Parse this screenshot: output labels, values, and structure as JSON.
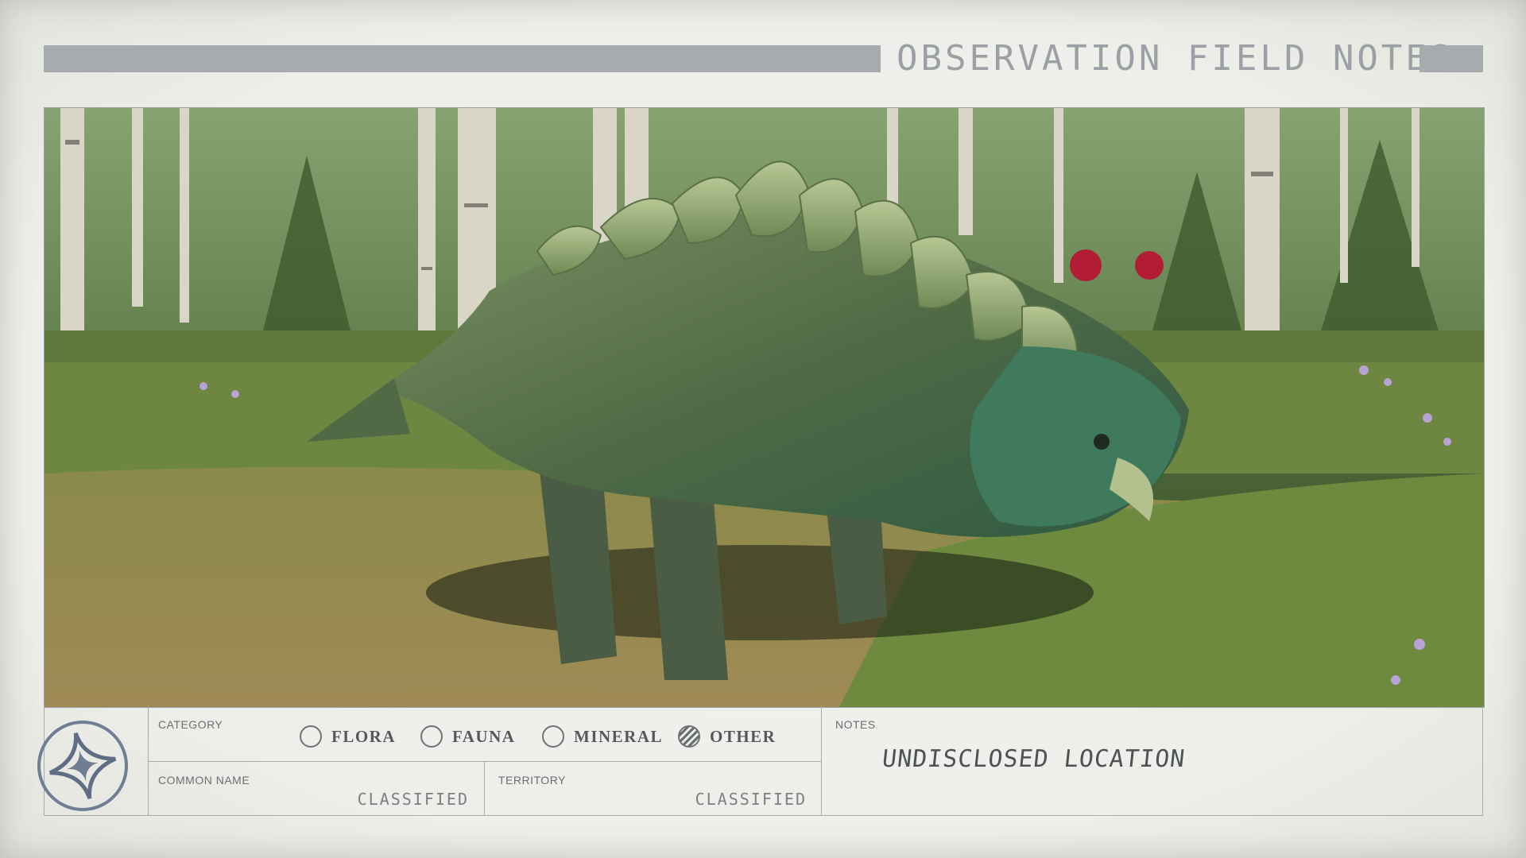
{
  "header": {
    "title": "OBSERVATION FIELD NOTES"
  },
  "photo": {
    "subject_icon": "armored-creature-image"
  },
  "category": {
    "label": "CATEGORY",
    "options": [
      {
        "label": "FLORA",
        "checked": false
      },
      {
        "label": "FAUNA",
        "checked": false
      },
      {
        "label": "MINERAL",
        "checked": false
      },
      {
        "label": "OTHER",
        "checked": true
      }
    ]
  },
  "common_name": {
    "label": "COMMON NAME",
    "value": "CLASSIFIED"
  },
  "territory": {
    "label": "TERRITORY",
    "value": "CLASSIFIED"
  },
  "notes": {
    "label": "NOTES",
    "value": "UNDISCLOSED LOCATION"
  },
  "emblem": {
    "icon": "star-seal-icon"
  },
  "colors": {
    "paper": "#eeeeea",
    "bar": "#a6abad",
    "ink": "#55595c"
  }
}
